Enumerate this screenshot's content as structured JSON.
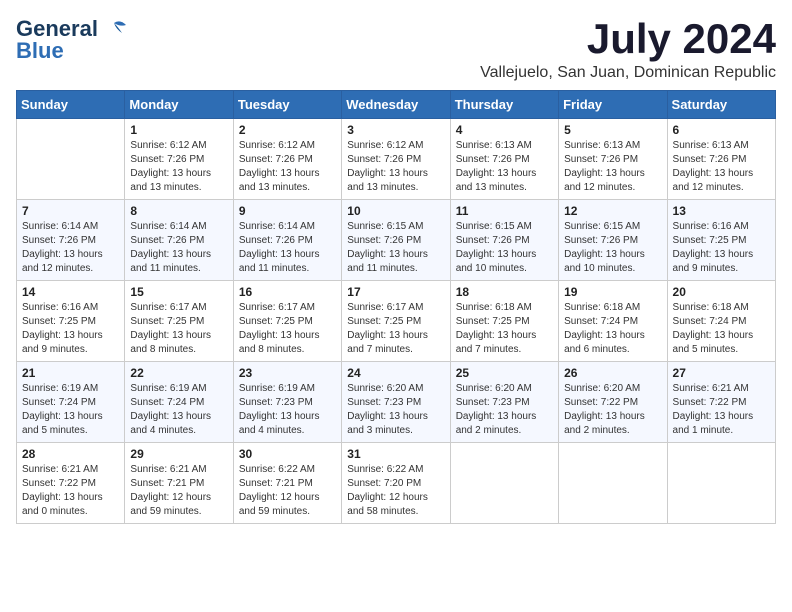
{
  "logo": {
    "line1": "General",
    "line2": "Blue"
  },
  "title": "July 2024",
  "location": "Vallejuelo, San Juan, Dominican Republic",
  "days_of_week": [
    "Sunday",
    "Monday",
    "Tuesday",
    "Wednesday",
    "Thursday",
    "Friday",
    "Saturday"
  ],
  "weeks": [
    [
      {
        "day": "",
        "sunrise": "",
        "sunset": "",
        "daylight": ""
      },
      {
        "day": "1",
        "sunrise": "Sunrise: 6:12 AM",
        "sunset": "Sunset: 7:26 PM",
        "daylight": "Daylight: 13 hours and 13 minutes."
      },
      {
        "day": "2",
        "sunrise": "Sunrise: 6:12 AM",
        "sunset": "Sunset: 7:26 PM",
        "daylight": "Daylight: 13 hours and 13 minutes."
      },
      {
        "day": "3",
        "sunrise": "Sunrise: 6:12 AM",
        "sunset": "Sunset: 7:26 PM",
        "daylight": "Daylight: 13 hours and 13 minutes."
      },
      {
        "day": "4",
        "sunrise": "Sunrise: 6:13 AM",
        "sunset": "Sunset: 7:26 PM",
        "daylight": "Daylight: 13 hours and 13 minutes."
      },
      {
        "day": "5",
        "sunrise": "Sunrise: 6:13 AM",
        "sunset": "Sunset: 7:26 PM",
        "daylight": "Daylight: 13 hours and 12 minutes."
      },
      {
        "day": "6",
        "sunrise": "Sunrise: 6:13 AM",
        "sunset": "Sunset: 7:26 PM",
        "daylight": "Daylight: 13 hours and 12 minutes."
      }
    ],
    [
      {
        "day": "7",
        "sunrise": "Sunrise: 6:14 AM",
        "sunset": "Sunset: 7:26 PM",
        "daylight": "Daylight: 13 hours and 12 minutes."
      },
      {
        "day": "8",
        "sunrise": "Sunrise: 6:14 AM",
        "sunset": "Sunset: 7:26 PM",
        "daylight": "Daylight: 13 hours and 11 minutes."
      },
      {
        "day": "9",
        "sunrise": "Sunrise: 6:14 AM",
        "sunset": "Sunset: 7:26 PM",
        "daylight": "Daylight: 13 hours and 11 minutes."
      },
      {
        "day": "10",
        "sunrise": "Sunrise: 6:15 AM",
        "sunset": "Sunset: 7:26 PM",
        "daylight": "Daylight: 13 hours and 11 minutes."
      },
      {
        "day": "11",
        "sunrise": "Sunrise: 6:15 AM",
        "sunset": "Sunset: 7:26 PM",
        "daylight": "Daylight: 13 hours and 10 minutes."
      },
      {
        "day": "12",
        "sunrise": "Sunrise: 6:15 AM",
        "sunset": "Sunset: 7:26 PM",
        "daylight": "Daylight: 13 hours and 10 minutes."
      },
      {
        "day": "13",
        "sunrise": "Sunrise: 6:16 AM",
        "sunset": "Sunset: 7:25 PM",
        "daylight": "Daylight: 13 hours and 9 minutes."
      }
    ],
    [
      {
        "day": "14",
        "sunrise": "Sunrise: 6:16 AM",
        "sunset": "Sunset: 7:25 PM",
        "daylight": "Daylight: 13 hours and 9 minutes."
      },
      {
        "day": "15",
        "sunrise": "Sunrise: 6:17 AM",
        "sunset": "Sunset: 7:25 PM",
        "daylight": "Daylight: 13 hours and 8 minutes."
      },
      {
        "day": "16",
        "sunrise": "Sunrise: 6:17 AM",
        "sunset": "Sunset: 7:25 PM",
        "daylight": "Daylight: 13 hours and 8 minutes."
      },
      {
        "day": "17",
        "sunrise": "Sunrise: 6:17 AM",
        "sunset": "Sunset: 7:25 PM",
        "daylight": "Daylight: 13 hours and 7 minutes."
      },
      {
        "day": "18",
        "sunrise": "Sunrise: 6:18 AM",
        "sunset": "Sunset: 7:25 PM",
        "daylight": "Daylight: 13 hours and 7 minutes."
      },
      {
        "day": "19",
        "sunrise": "Sunrise: 6:18 AM",
        "sunset": "Sunset: 7:24 PM",
        "daylight": "Daylight: 13 hours and 6 minutes."
      },
      {
        "day": "20",
        "sunrise": "Sunrise: 6:18 AM",
        "sunset": "Sunset: 7:24 PM",
        "daylight": "Daylight: 13 hours and 5 minutes."
      }
    ],
    [
      {
        "day": "21",
        "sunrise": "Sunrise: 6:19 AM",
        "sunset": "Sunset: 7:24 PM",
        "daylight": "Daylight: 13 hours and 5 minutes."
      },
      {
        "day": "22",
        "sunrise": "Sunrise: 6:19 AM",
        "sunset": "Sunset: 7:24 PM",
        "daylight": "Daylight: 13 hours and 4 minutes."
      },
      {
        "day": "23",
        "sunrise": "Sunrise: 6:19 AM",
        "sunset": "Sunset: 7:23 PM",
        "daylight": "Daylight: 13 hours and 4 minutes."
      },
      {
        "day": "24",
        "sunrise": "Sunrise: 6:20 AM",
        "sunset": "Sunset: 7:23 PM",
        "daylight": "Daylight: 13 hours and 3 minutes."
      },
      {
        "day": "25",
        "sunrise": "Sunrise: 6:20 AM",
        "sunset": "Sunset: 7:23 PM",
        "daylight": "Daylight: 13 hours and 2 minutes."
      },
      {
        "day": "26",
        "sunrise": "Sunrise: 6:20 AM",
        "sunset": "Sunset: 7:22 PM",
        "daylight": "Daylight: 13 hours and 2 minutes."
      },
      {
        "day": "27",
        "sunrise": "Sunrise: 6:21 AM",
        "sunset": "Sunset: 7:22 PM",
        "daylight": "Daylight: 13 hours and 1 minute."
      }
    ],
    [
      {
        "day": "28",
        "sunrise": "Sunrise: 6:21 AM",
        "sunset": "Sunset: 7:22 PM",
        "daylight": "Daylight: 13 hours and 0 minutes."
      },
      {
        "day": "29",
        "sunrise": "Sunrise: 6:21 AM",
        "sunset": "Sunset: 7:21 PM",
        "daylight": "Daylight: 12 hours and 59 minutes."
      },
      {
        "day": "30",
        "sunrise": "Sunrise: 6:22 AM",
        "sunset": "Sunset: 7:21 PM",
        "daylight": "Daylight: 12 hours and 59 minutes."
      },
      {
        "day": "31",
        "sunrise": "Sunrise: 6:22 AM",
        "sunset": "Sunset: 7:20 PM",
        "daylight": "Daylight: 12 hours and 58 minutes."
      },
      {
        "day": "",
        "sunrise": "",
        "sunset": "",
        "daylight": ""
      },
      {
        "day": "",
        "sunrise": "",
        "sunset": "",
        "daylight": ""
      },
      {
        "day": "",
        "sunrise": "",
        "sunset": "",
        "daylight": ""
      }
    ]
  ]
}
